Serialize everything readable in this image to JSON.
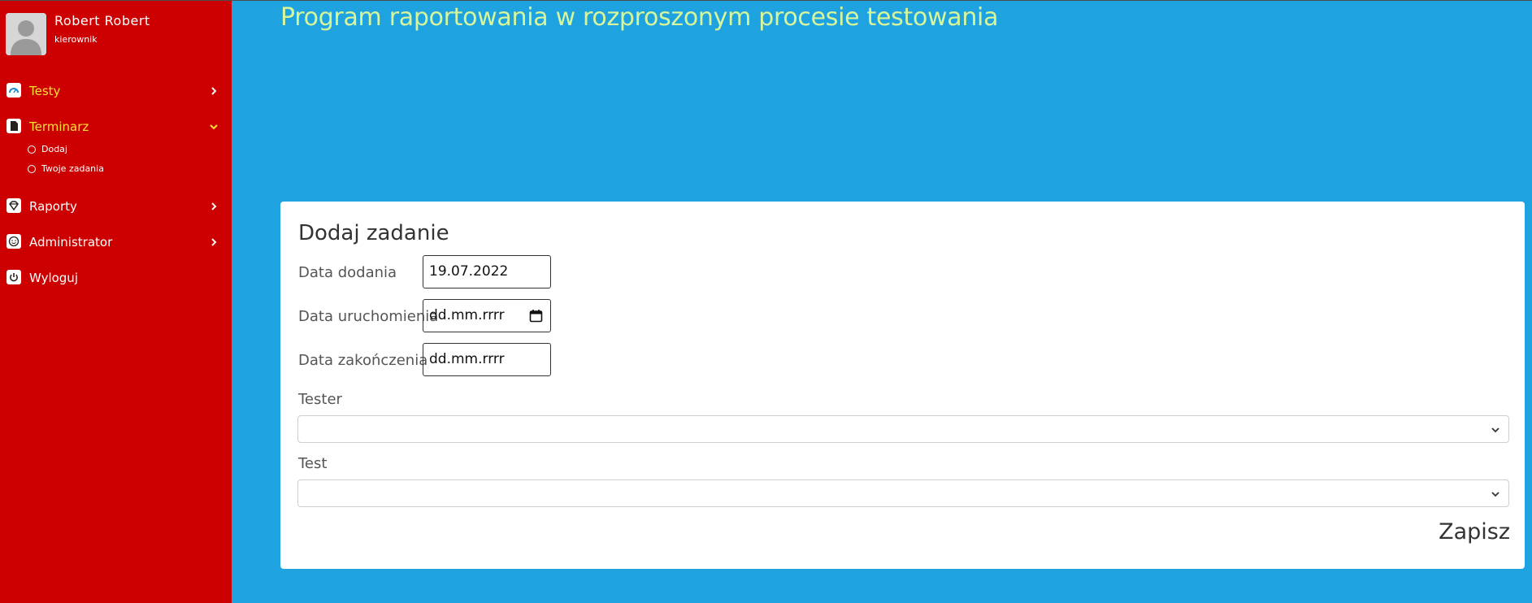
{
  "user": {
    "name": "Robert Robert",
    "role": "kierownik"
  },
  "nav": {
    "testy": {
      "label": "Testy",
      "icon": "gauge-icon"
    },
    "terminarz": {
      "label": "Terminarz",
      "icon": "document-icon"
    },
    "terminarz_sub": {
      "dodaj": "Dodaj",
      "twoje": "Twoje zadania"
    },
    "raporty": {
      "label": "Raporty",
      "icon": "diamond-icon"
    },
    "administrator": {
      "label": "Administrator",
      "icon": "smiley-icon"
    },
    "wyloguj": {
      "label": "Wyloguj",
      "icon": "power-icon"
    }
  },
  "page": {
    "title": "Program raportowania w rozproszonym procesie testowania"
  },
  "form": {
    "title": "Dodaj zadanie",
    "data_dodania_label": "Data dodania",
    "data_dodania_value": "19.07.2022",
    "data_uruchomienia_label": "Data uruchomienia",
    "data_uruchomienia_value": "dd.mm.rrrr",
    "data_zakonczenia_label": "Data zakończenia",
    "data_zakonczenia_value": "dd.mm.rrrr",
    "tester_label": "Tester",
    "tester_value": "",
    "test_label": "Test",
    "test_value": "",
    "save_label": "Zapisz"
  },
  "colors": {
    "sidebar": "#cc0000",
    "main_bg": "#1ea2e0",
    "active_nav": "#ffe033",
    "title": "#d7f59a"
  }
}
